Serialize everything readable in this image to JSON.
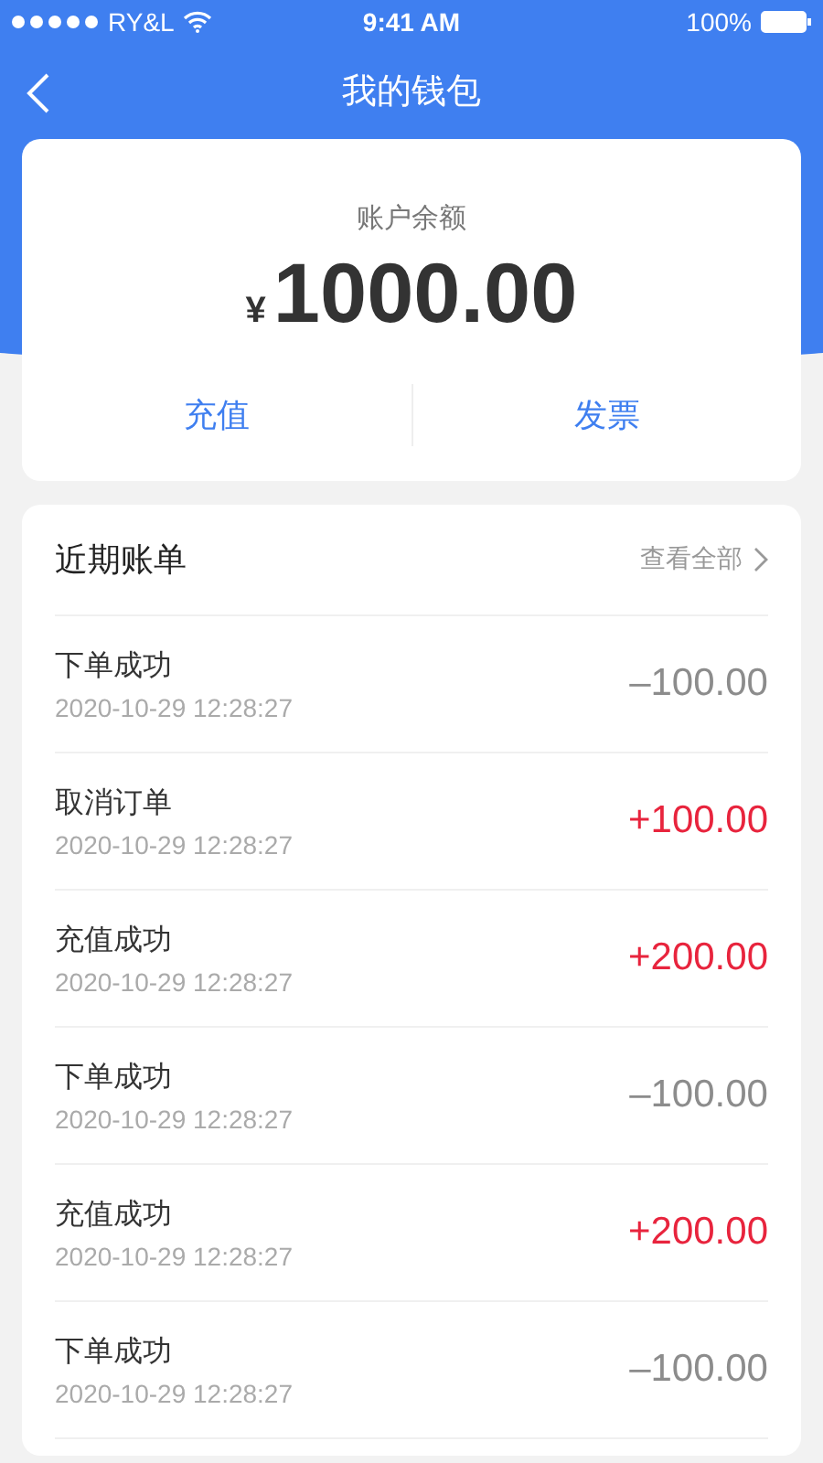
{
  "status_bar": {
    "carrier": "RY&L",
    "time": "9:41 AM",
    "battery": "100%"
  },
  "nav": {
    "title": "我的钱包"
  },
  "balance": {
    "label": "账户余额",
    "currency": "¥",
    "amount": "1000.00",
    "actions": [
      "充值",
      "发票"
    ]
  },
  "bills": {
    "title": "近期账单",
    "view_all": "查看全部",
    "rows": [
      {
        "title": "下单成功",
        "time": "2020-10-29 12:28:27",
        "amount": "–100.00",
        "kind": "expense"
      },
      {
        "title": "取消订单",
        "time": "2020-10-29 12:28:27",
        "amount": "+100.00",
        "kind": "income"
      },
      {
        "title": "充值成功",
        "time": "2020-10-29 12:28:27",
        "amount": "+200.00",
        "kind": "income"
      },
      {
        "title": "下单成功",
        "time": "2020-10-29 12:28:27",
        "amount": "–100.00",
        "kind": "expense"
      },
      {
        "title": "充值成功",
        "time": "2020-10-29 12:28:27",
        "amount": "+200.00",
        "kind": "income"
      },
      {
        "title": "下单成功",
        "time": "2020-10-29 12:28:27",
        "amount": "–100.00",
        "kind": "expense"
      }
    ]
  }
}
